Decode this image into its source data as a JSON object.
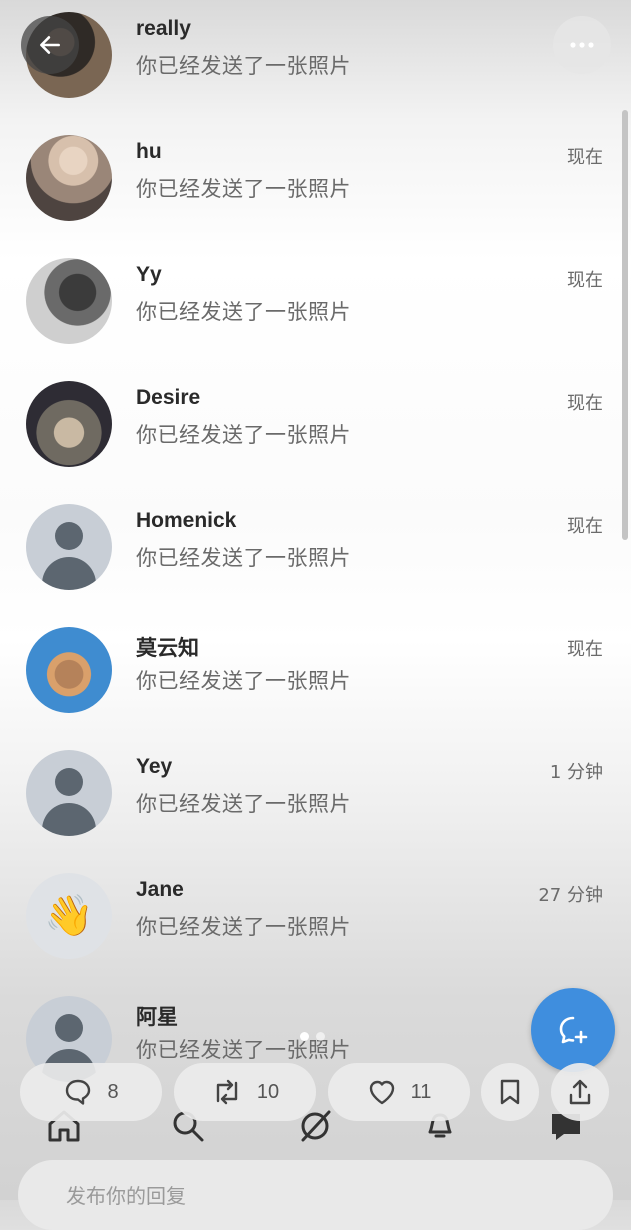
{
  "messages": [
    {
      "name": "really",
      "preview": "你已经发送了一张照片",
      "time": "",
      "avatar": "photo1"
    },
    {
      "name": "hu",
      "preview": "你已经发送了一张照片",
      "time": "现在",
      "avatar": "photo2"
    },
    {
      "name": "Yy",
      "preview": "你已经发送了一张照片",
      "time": "现在",
      "avatar": "photo3"
    },
    {
      "name": "Desire",
      "preview": "你已经发送了一张照片",
      "time": "现在",
      "avatar": "photo4"
    },
    {
      "name": "Homenick",
      "preview": "你已经发送了一张照片",
      "time": "现在",
      "avatar": "default"
    },
    {
      "name": "莫云知",
      "preview": "你已经发送了一张照片",
      "time": "现在",
      "avatar": "ape"
    },
    {
      "name": "Yey",
      "preview": "你已经发送了一张照片",
      "time": "1 分钟",
      "avatar": "default"
    },
    {
      "name": "Jane",
      "preview": "你已经发送了一张照片",
      "time": "27 分钟",
      "avatar": "emoji",
      "emoji": "👋"
    },
    {
      "name": "阿星",
      "preview": "你已经发送了一张照片",
      "time": "",
      "avatar": "default"
    }
  ],
  "actions": {
    "replies": "8",
    "reposts": "10",
    "likes": "11"
  },
  "reply": {
    "placeholder": "发布你的回复"
  },
  "colors": {
    "accent": "#3f8ede",
    "text_primary": "#2a2a2a",
    "text_secondary": "#6a6a6a"
  },
  "icons": {
    "back": "arrow-left-icon",
    "more": "more-dots-icon",
    "compose": "new-message-icon",
    "reply": "comment-icon",
    "repost": "repost-icon",
    "like": "heart-icon",
    "bookmark": "bookmark-icon",
    "share": "share-icon",
    "tabs": [
      "home-icon",
      "search-icon",
      "grok-icon",
      "notifications-icon",
      "messages-icon"
    ]
  }
}
